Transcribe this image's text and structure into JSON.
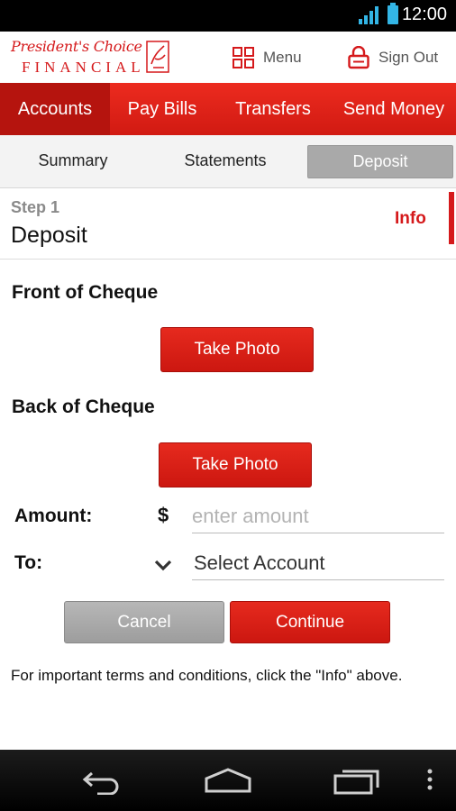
{
  "status_bar": {
    "time": "12:00"
  },
  "header": {
    "logo_script": "President's Choice",
    "logo_financial": "FINANCIAL",
    "menu_label": "Menu",
    "signout_label": "Sign Out"
  },
  "nav": {
    "tabs": [
      {
        "label": "Accounts",
        "active": true
      },
      {
        "label": "Pay Bills",
        "active": false
      },
      {
        "label": "Transfers",
        "active": false
      },
      {
        "label": "Send Money",
        "active": false
      }
    ]
  },
  "subnav": {
    "items": [
      {
        "label": "Summary",
        "active": false
      },
      {
        "label": "Statements",
        "active": false
      },
      {
        "label": "Deposit",
        "active": true
      }
    ]
  },
  "step": {
    "number": "Step 1",
    "title": "Deposit",
    "info_label": "Info"
  },
  "front": {
    "heading": "Front of Cheque",
    "button": "Take Photo"
  },
  "back": {
    "heading": "Back of Cheque",
    "button": "Take Photo"
  },
  "amount": {
    "label": "Amount:",
    "currency": "$",
    "placeholder": "enter amount",
    "value": ""
  },
  "to": {
    "label": "To:",
    "selected": "Select Account"
  },
  "actions": {
    "cancel": "Cancel",
    "continue": "Continue"
  },
  "terms": "For important terms and conditions, click the \"Info\" above.",
  "colors": {
    "brand_red": "#d5191b",
    "nav_red": "#e52a1e",
    "grey_button": "#a9a9a9"
  }
}
